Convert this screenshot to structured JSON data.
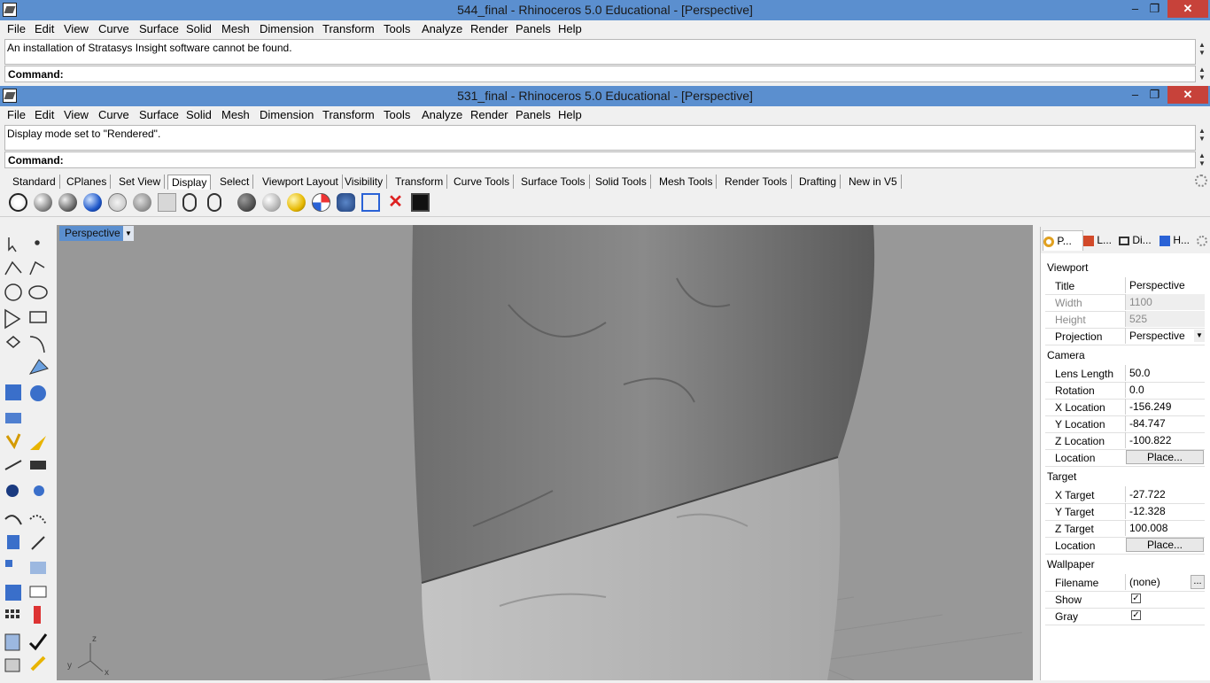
{
  "window1": {
    "title": "544_final - Rhinoceros 5.0 Educational - [Perspective]",
    "history_text": "An installation of Stratasys Insight software cannot be found.",
    "command_label": "Command:"
  },
  "window2": {
    "title": "531_final - Rhinoceros 5.0 Educational - [Perspective]",
    "history_text": "Display mode set to \"Rendered\".",
    "command_label": "Command:"
  },
  "window_controls": {
    "minimize": "–",
    "maximize": "❐",
    "close": "✕"
  },
  "menu": [
    "File",
    "Edit",
    "View",
    "Curve",
    "Surface",
    "Solid",
    "Mesh",
    "Dimension",
    "Transform",
    "Tools",
    "Analyze",
    "Render",
    "Panels",
    "Help"
  ],
  "toolbar_tabs": [
    "Standard",
    "CPlanes",
    "Set View",
    "Display",
    "Select",
    "Viewport Layout",
    "Visibility",
    "Transform",
    "Curve Tools",
    "Surface Tools",
    "Solid Tools",
    "Mesh Tools",
    "Render Tools",
    "Drafting",
    "New in V5"
  ],
  "active_tab": "Display",
  "display_tools": [
    "wireframe-icon",
    "shaded-icon",
    "rendered-icon",
    "rendered-blue-icon",
    "ghosted-icon",
    "xray-icon",
    "technical-icon",
    "artistic-icon",
    "pen-icon",
    "globe-icon",
    "sphere-icon",
    "gold-sphere-icon",
    "cplane-icon",
    "camera-icon",
    "capture-icon",
    "lights-off-icon",
    "monitor-icon"
  ],
  "viewport": {
    "name": "Perspective",
    "axis_z": "z",
    "axis_y": "y",
    "axis_x": "x"
  },
  "panel": {
    "tabs": [
      {
        "label": "P...",
        "icon": "properties-icon"
      },
      {
        "label": "L...",
        "icon": "layers-icon"
      },
      {
        "label": "Di...",
        "icon": "display-icon"
      },
      {
        "label": "H...",
        "icon": "help-icon"
      }
    ],
    "viewport_section": "Viewport",
    "title_key": "Title",
    "title_val": "Perspective",
    "width_key": "Width",
    "width_val": "1100",
    "height_key": "Height",
    "height_val": "525",
    "projection_key": "Projection",
    "projection_val": "Perspective",
    "camera_section": "Camera",
    "lens_key": "Lens Length",
    "lens_val": "50.0",
    "rotation_key": "Rotation",
    "rotation_val": "0.0",
    "xloc_key": "X Location",
    "xloc_val": "-156.249",
    "yloc_key": "Y Location",
    "yloc_val": "-84.747",
    "zloc_key": "Z Location",
    "zloc_val": "-100.822",
    "loc_key": "Location",
    "place_label": "Place...",
    "target_section": "Target",
    "xt_key": "X Target",
    "xt_val": "-27.722",
    "yt_key": "Y Target",
    "yt_val": "-12.328",
    "zt_key": "Z Target",
    "zt_val": "100.008",
    "tloc_key": "Location",
    "tplace_label": "Place...",
    "wallpaper_section": "Wallpaper",
    "filename_key": "Filename",
    "filename_val": "(none)",
    "browse_label": "...",
    "show_key": "Show",
    "show_checked": true,
    "gray_key": "Gray",
    "gray_checked": true,
    "check_mark": "✓"
  }
}
